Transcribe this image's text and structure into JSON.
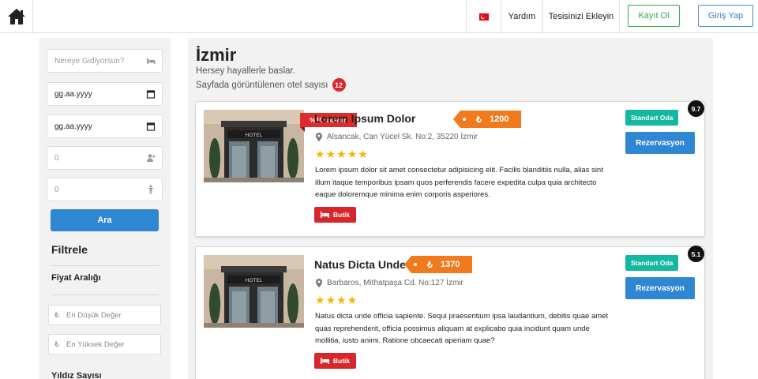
{
  "header": {
    "nav_help": "Yardım",
    "nav_add_property": "Tesisinizi Ekleyin",
    "register_label": "Kayıt Ol",
    "login_label": "Giriş Yap"
  },
  "sidebar": {
    "destination_placeholder": "Nereye Gidiyorsun?",
    "checkin_value": "gg.aa.yyyy",
    "checkout_value": "gg.aa.yyyy",
    "adults_value": "0",
    "children_value": "0",
    "search_label": "Ara",
    "filter_title": "Filtrele",
    "price_range_title": "Fiyat Aralığı",
    "currency_symbol": "₺",
    "min_price_placeholder": "En Düşük Değer",
    "max_price_placeholder": "En Yüksek Değer",
    "star_count_title": "Yıldız Sayısı"
  },
  "main": {
    "city": "İzmir",
    "subtitle": "Hersey hayallerle baslar.",
    "count_label": "Sayfada görüntülenen otel sayısı",
    "count_value": "12"
  },
  "hotels": [
    {
      "name": "Lorem Ipsum Dolor",
      "discount": "%10 indirim",
      "currency": "₺",
      "price": "1200",
      "address": "Alsancak, Can Yücel Sk. No:2, 35220 İzmir",
      "stars": 5,
      "description": "Lorem ipsum dolor sit amet consectetur adipisicing elit. Facilis blanditiis nulla, alias sint illum itaque temporibus ipsam quos perferendis facere expedita culpa quia architecto eaque doloremque minima enim corporis asperiores.",
      "type": "Butik",
      "room_type": "Standart Oda",
      "reserve_label": "Rezervasyon",
      "score": "9.7",
      "image_sign": "HOTEL"
    },
    {
      "name": "Natus Dicta Unde",
      "currency": "₺",
      "price": "1370",
      "address": "Barbaros, Mithatpaşa Cd. No:127 İzmir",
      "stars": 4,
      "description": "Natus dicta unde officia sapiente. Sequi praesentium ipsa laudantium, debitis quae amet quas reprehenderit, officia possimus aliquam at explicabo quia incidunt quam unde mollitia, iusto animi. Ratione obcaecati aperiam quae?",
      "type": "Butik",
      "room_type": "Standart Oda",
      "reserve_label": "Rezervasyon",
      "score": "5.1",
      "image_sign": "HOTEL"
    }
  ],
  "colors": {
    "primary_blue": "#2f86d3",
    "badge_red": "#d9262b",
    "price_orange": "#f07a1c",
    "room_teal": "#14b7a0",
    "star_gold": "#f2b705",
    "register_green": "#2eaa4a"
  }
}
